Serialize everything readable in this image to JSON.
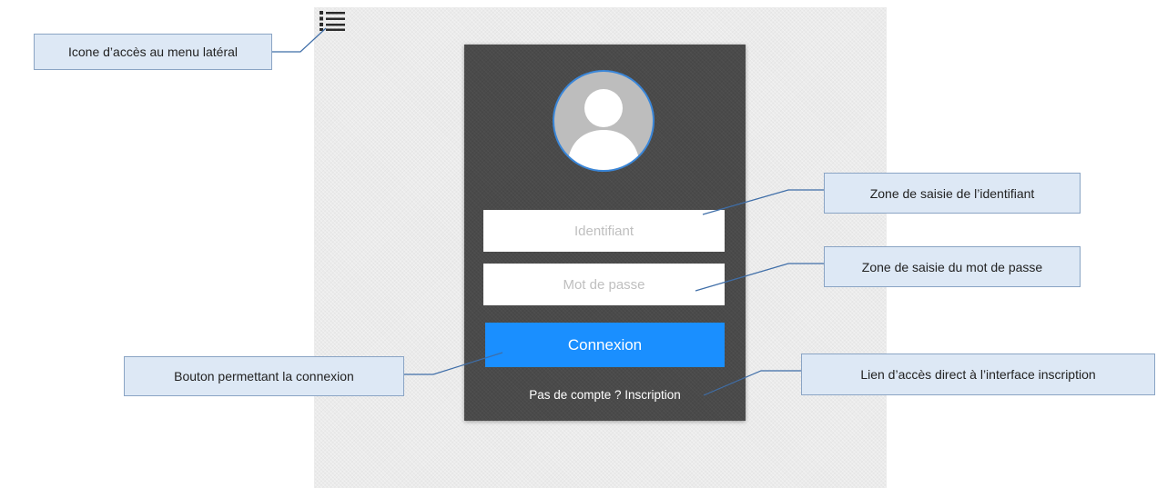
{
  "login": {
    "username_placeholder": "Identifiant",
    "password_placeholder": "Mot de passe",
    "connect_label": "Connexion",
    "signup_text": "Pas de compte ? Inscription"
  },
  "annotations": {
    "menu_icon": "Icone d’accès au menu latéral",
    "username": "Zone de saisie de l’identifiant",
    "password": "Zone de saisie du mot de passe",
    "connect": "Bouton permettant la connexion",
    "signup": "Lien d’accès direct à l’interface inscription"
  },
  "colors": {
    "card": "#4a4a4a",
    "button": "#1a8fff",
    "avatar_ring": "#3a86d8",
    "callout_bg": "#dde8f5",
    "callout_border": "#8aa4c4"
  },
  "icons": {
    "menu": "list-menu-icon",
    "avatar": "user-avatar-icon"
  }
}
